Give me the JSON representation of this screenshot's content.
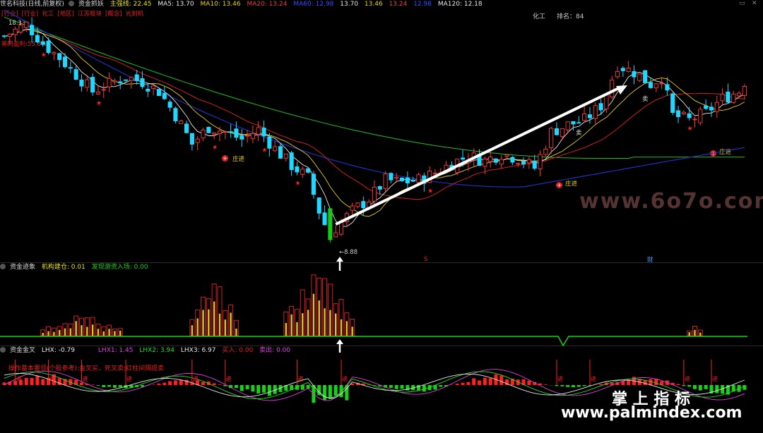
{
  "main_header": {
    "stock_name": "世名科技(日线,前复权)",
    "indicator_name": "资金抓妖",
    "main_line_label": "主强线: 22.45",
    "ma5": "MA5: 13.70",
    "ma10": "MA10: 13.46",
    "ma20": "MA20: 13.24",
    "ma60": "MA60: 12.98",
    "v1": "13.70",
    "v2": "13.46",
    "v3": "13.24",
    "v4": "12.98",
    "ma120": "MA120: 12.18"
  },
  "tags": [
    "[行业]",
    "[行业]",
    "化工",
    "[地区]",
    "江苏板块",
    "[概念]",
    "光刻机"
  ],
  "chip_profit": "筹码盈利:53.8%",
  "top_price": "18.13",
  "sector_label": "化工",
  "rank_label": "排名：84",
  "low_price": "←8.88",
  "zhuangjin_label": "庄进",
  "sell_label": "卖",
  "s_label": "S",
  "cai_label": "财",
  "fund_header": {
    "name": "资金迹象",
    "inst": "机构建仓: 0.01",
    "retail": "发现游资入场: 0.00"
  },
  "cross_header": {
    "name": "资金金叉",
    "lhx": "LHX: -0.79",
    "lhx1": "LHX1: 1.45",
    "lhx2": "LHX2: 3.94",
    "lhx3": "LHX3: 6.97",
    "buy": "买入: 0.00",
    "sell": "卖出: 0.00"
  },
  "cross_note": "操作基本要领(个股参考):金叉买，死叉卖;红柱间隔提卖",
  "jin_label": "进",
  "watermark1": "www.6o7o.com",
  "watermark2": "掌 上 指 标",
  "watermark3": "www.palmindex.com",
  "colors": {
    "up": "#ff3b3b",
    "down": "#20d8ff",
    "bigdown": "#18c818",
    "ma5": "#e8e8e8",
    "ma10": "#e8d020",
    "ma20": "#d02020",
    "ma60": "#2030c0",
    "ma120": "#20c020"
  },
  "chart_data": [
    {
      "type": "candlestick",
      "title": "资金抓妖",
      "x": "trading days (index 0–134)",
      "y_unit": "price",
      "annotations": {
        "max": 18.13,
        "min": 8.88
      },
      "series": [
        {
          "name": "MA5",
          "last": 13.7
        },
        {
          "name": "MA10",
          "last": 13.46
        },
        {
          "name": "MA20",
          "last": 13.24
        },
        {
          "name": "MA60",
          "last": 12.98
        },
        {
          "name": "MA120",
          "last": 12.18
        }
      ],
      "price_knots": [
        [
          0,
          17.5
        ],
        [
          4,
          18.0
        ],
        [
          7,
          17.2
        ],
        [
          10,
          16.6
        ],
        [
          13,
          15.9
        ],
        [
          16,
          15.2
        ],
        [
          19,
          15.5
        ],
        [
          22,
          15.8
        ],
        [
          25,
          15.6
        ],
        [
          28,
          15.2
        ],
        [
          31,
          14.2
        ],
        [
          34,
          13.0
        ],
        [
          37,
          13.7
        ],
        [
          40,
          13.5
        ],
        [
          43,
          13.2
        ],
        [
          46,
          13.6
        ],
        [
          49,
          12.8
        ],
        [
          52,
          12.1
        ],
        [
          55,
          11.6
        ],
        [
          57,
          10.2
        ],
        [
          59,
          9.1
        ],
        [
          60,
          9.5
        ],
        [
          63,
          10.2
        ],
        [
          66,
          10.7
        ],
        [
          69,
          11.5
        ],
        [
          72,
          11.4
        ],
        [
          75,
          11.5
        ],
        [
          78,
          11.8
        ],
        [
          81,
          12.2
        ],
        [
          84,
          12.5
        ],
        [
          87,
          12.3
        ],
        [
          90,
          12.6
        ],
        [
          93,
          12.4
        ],
        [
          96,
          12.0
        ],
        [
          99,
          13.5
        ],
        [
          102,
          13.8
        ],
        [
          105,
          14.0
        ],
        [
          108,
          14.6
        ],
        [
          111,
          16.3
        ],
        [
          114,
          16.0
        ],
        [
          117,
          15.5
        ],
        [
          119,
          15.8
        ],
        [
          121,
          14.2
        ],
        [
          124,
          14.0
        ],
        [
          127,
          14.3
        ],
        [
          130,
          14.9
        ],
        [
          133,
          15.2
        ],
        [
          134,
          15.6
        ]
      ]
    },
    {
      "type": "bar",
      "title": "资金迹象",
      "series": [
        {
          "name": "机构建仓",
          "last": 0.01
        },
        {
          "name": "发现游资入场",
          "last": 0.0
        }
      ],
      "clusters": [
        {
          "start": 7,
          "end": 21,
          "peak": 0.3
        },
        {
          "start": 34,
          "end": 42,
          "peak": 0.75
        },
        {
          "start": 51,
          "end": 63,
          "peak": 0.95
        },
        {
          "start": 124,
          "end": 126,
          "peak": 0.15
        }
      ]
    },
    {
      "type": "line",
      "title": "资金金叉",
      "series": [
        {
          "name": "LHX",
          "last": -0.79
        },
        {
          "name": "LHX1",
          "last": 1.45
        },
        {
          "name": "LHX2",
          "last": 3.94
        },
        {
          "name": "LHX3",
          "last": 6.97
        },
        {
          "name": "买入",
          "last": 0.0
        },
        {
          "name": "卖出",
          "last": 0.0
        }
      ]
    }
  ]
}
